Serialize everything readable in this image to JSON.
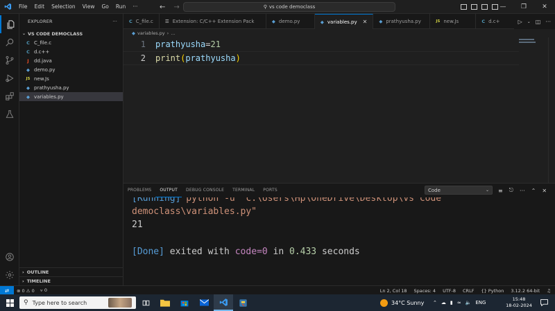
{
  "titlebar": {
    "menu": [
      "File",
      "Edit",
      "Selection",
      "View",
      "Go",
      "Run",
      "···"
    ],
    "search": "vs code democlass"
  },
  "sidebar": {
    "header": "EXPLORER",
    "more": "···",
    "folder": "VS CODE DEMOCLASS",
    "files": [
      {
        "icon": "C",
        "name": "C_file.c",
        "color": "#519aba"
      },
      {
        "icon": "C",
        "name": "d.c++",
        "color": "#519aba"
      },
      {
        "icon": "J",
        "name": "dd.java",
        "color": "#e34c26"
      },
      {
        "icon": "◆",
        "name": "demo.py",
        "color": "#5a9fd4"
      },
      {
        "icon": "JS",
        "name": "new.Js",
        "color": "#cbcb41"
      },
      {
        "icon": "◆",
        "name": "prathyusha.py",
        "color": "#5a9fd4"
      },
      {
        "icon": "◆",
        "name": "variables.py",
        "color": "#5a9fd4"
      }
    ],
    "outline": "OUTLINE",
    "timeline": "TIMELINE"
  },
  "tabs": [
    {
      "icon": "C",
      "label": "C_file.c",
      "color": "#519aba"
    },
    {
      "icon": "☰",
      "label": "Extension: C/C++ Extension Pack",
      "color": "#cccccc"
    },
    {
      "icon": "◆",
      "label": "demo.py",
      "color": "#5a9fd4"
    },
    {
      "icon": "◆",
      "label": "variables.py",
      "color": "#5a9fd4"
    },
    {
      "icon": "◆",
      "label": "prathyusha.py",
      "color": "#5a9fd4"
    },
    {
      "icon": "JS",
      "label": "new.Js",
      "color": "#cbcb41"
    },
    {
      "icon": "C",
      "label": "d.c+",
      "color": "#519aba"
    }
  ],
  "breadcrumb": {
    "file": "variables.py",
    "more": "…"
  },
  "editor": {
    "lines": [
      {
        "num": "1",
        "tokens": [
          [
            "var",
            "prathyusha"
          ],
          [
            "op",
            "="
          ],
          [
            "num",
            "21"
          ]
        ]
      },
      {
        "num": "2",
        "tokens": [
          [
            "fn",
            "print"
          ],
          [
            "paren",
            "("
          ],
          [
            "var",
            "prathyusha"
          ],
          [
            "paren",
            ")"
          ]
        ]
      }
    ]
  },
  "panel": {
    "tabs": [
      "PROBLEMS",
      "OUTPUT",
      "DEBUG CONSOLE",
      "TERMINAL",
      "PORTS"
    ],
    "active_tab": 1,
    "output_channel": "Code",
    "output": {
      "running_tag": "[Running]",
      "running_cmd": " python -u \"c:\\Users\\Hp\\OneDrive\\Desktop\\vs code",
      "running_cmd2": "democlass\\variables.py\"",
      "result": "21",
      "done_tag": "[Done]",
      "done_text1": " exited with ",
      "done_code": "code=0",
      "done_in": " in ",
      "done_time": "0.433",
      "done_seconds": " seconds"
    }
  },
  "statusbar": {
    "errors": "0",
    "warnings": "0",
    "ports": "0",
    "position": "Ln 2, Col 18",
    "spaces": "Spaces: 4",
    "encoding": "UTF-8",
    "eol": "CRLF",
    "language": "Python",
    "interpreter": "3.12.2 64-bit"
  },
  "taskbar": {
    "search_placeholder": "Type here to search",
    "weather": "34°C  Sunny",
    "lang": "ENG",
    "time": "15:48",
    "date": "18-02-2024"
  }
}
